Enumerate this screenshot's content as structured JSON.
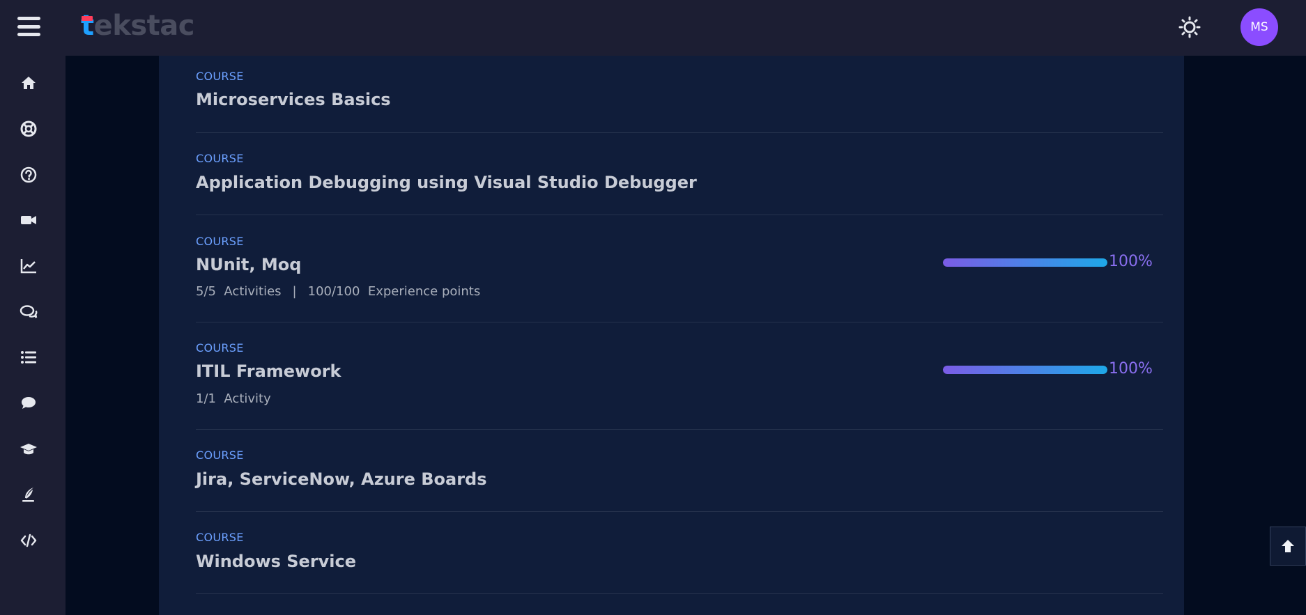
{
  "header": {
    "logo_text": "tekstac",
    "avatar_initials": "MS",
    "theme_icon": "sun-icon",
    "menu_icon": "hamburger-menu-icon"
  },
  "sidebar": {
    "icons": [
      "home-icon",
      "lifebuoy-icon",
      "help-circle-icon",
      "video-camera-icon",
      "line-chart-icon",
      "chat-bubbles-icon",
      "list-icon",
      "comment-icon",
      "graduation-cap-icon",
      "quill-icon",
      "code-icon"
    ]
  },
  "courses": [
    {
      "kind": "COURSE",
      "title": "Microservices Basics"
    },
    {
      "kind": "COURSE",
      "title": "Application Debugging using Visual Studio Debugger"
    },
    {
      "kind": "COURSE",
      "title": "NUnit, Moq",
      "activities": "5/5",
      "activities_label": "Activities",
      "separator": "|",
      "points": "100/100",
      "points_label": "Experience points",
      "progress": 100,
      "progress_label": "100%"
    },
    {
      "kind": "COURSE",
      "title": "ITIL Framework",
      "activities": "1/1",
      "activities_label": "Activity",
      "progress": 100,
      "progress_label": "100%"
    },
    {
      "kind": "COURSE",
      "title": "Jira, ServiceNow, Azure Boards"
    },
    {
      "kind": "COURSE",
      "title": "Windows Service"
    }
  ],
  "colors": {
    "accent": "#6ca0ff",
    "avatar": "#8b4dff",
    "progress_start": "#7b5ce6",
    "progress_end": "#1ea8e8"
  }
}
